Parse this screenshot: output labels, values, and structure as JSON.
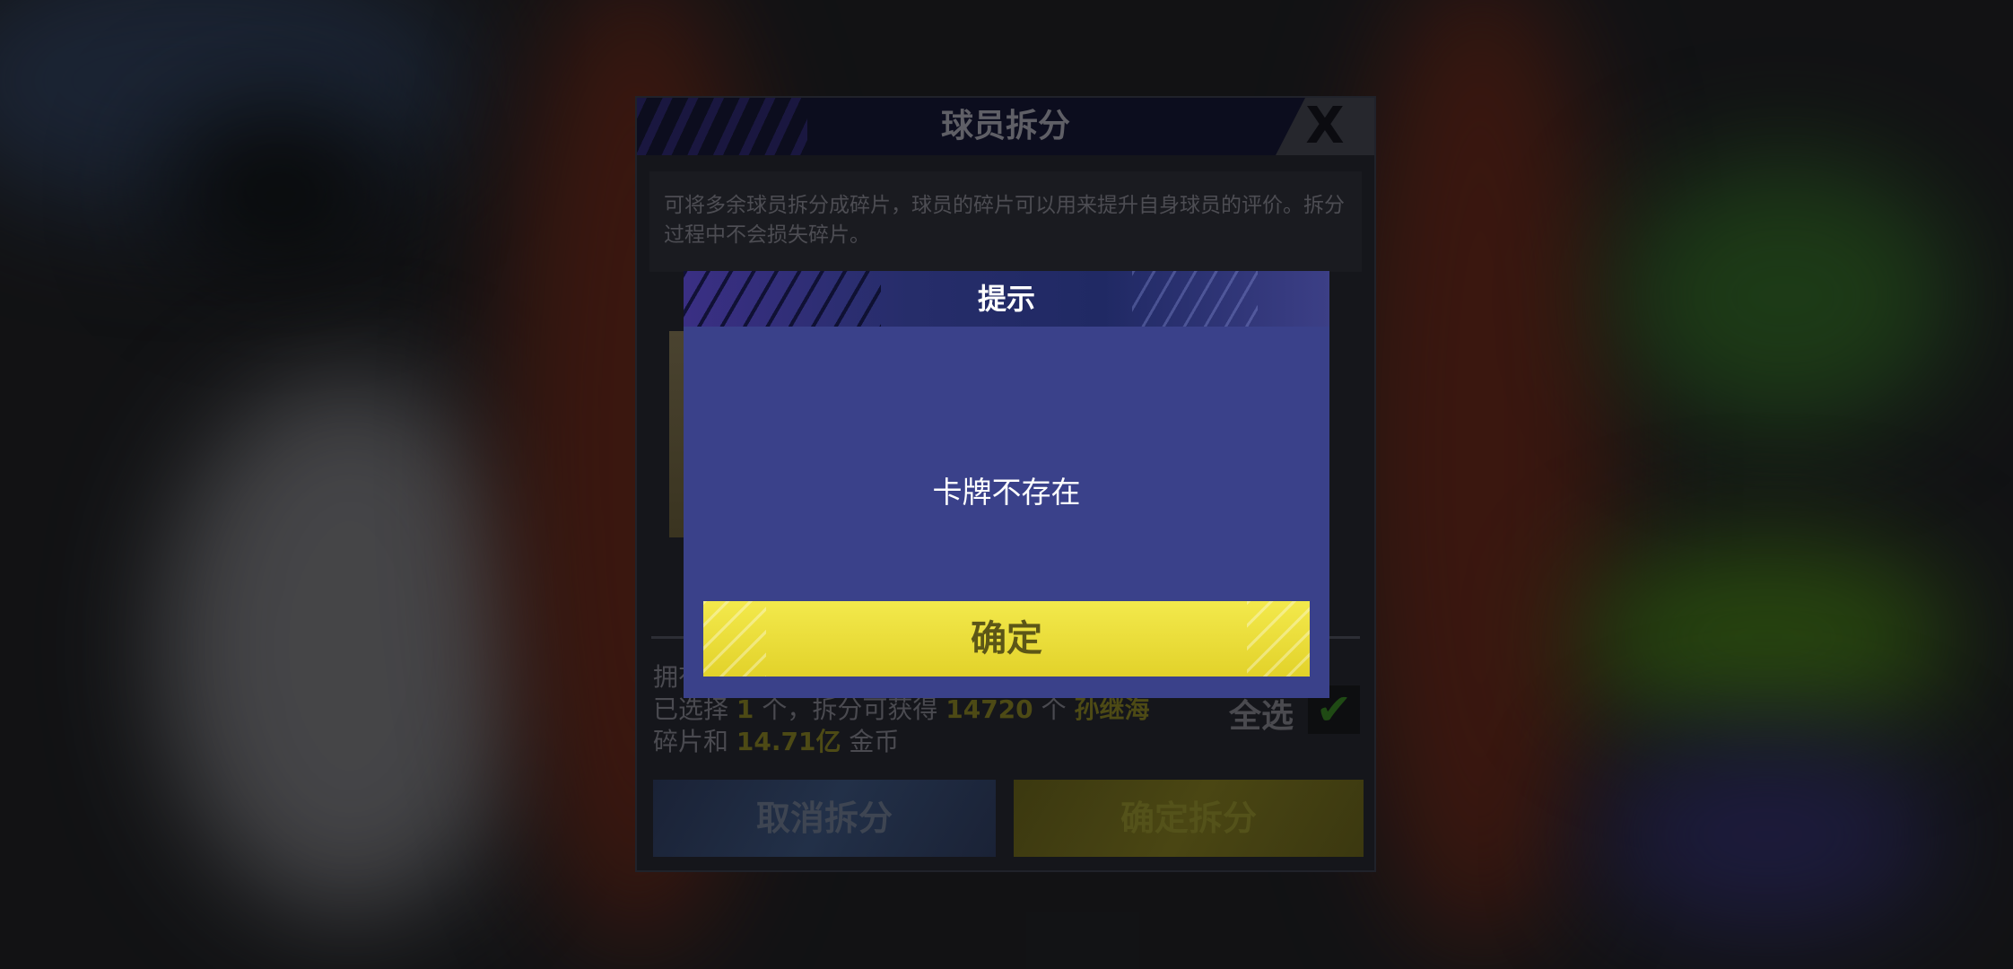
{
  "split_panel": {
    "title": "球员拆分",
    "close_label": "X",
    "description": "可将多余球员拆分成碎片，球员的碎片可以用来提升自身球员的评价。拆分过程中不会损失碎片。",
    "owned_partial": "拥有",
    "selected_prefix": "已选择",
    "selected_count": "1",
    "selected_mid": "个，拆分可获得",
    "fragment_count": "14720",
    "fragment_unit": "个",
    "player_name": "孙继海",
    "line2_prefix": "碎片和",
    "coin_amount": "14.71亿",
    "coin_label": "金币",
    "select_all_label": "全选",
    "select_all_checked": true,
    "cancel_label": "取消拆分",
    "confirm_label": "确定拆分"
  },
  "hint_dialog": {
    "title": "提示",
    "message": "卡牌不存在",
    "ok_label": "确定"
  },
  "colors": {
    "dialog_body": "#3a418a",
    "ok_button": "#f0e33e",
    "highlight_text": "#e2dd3a"
  }
}
